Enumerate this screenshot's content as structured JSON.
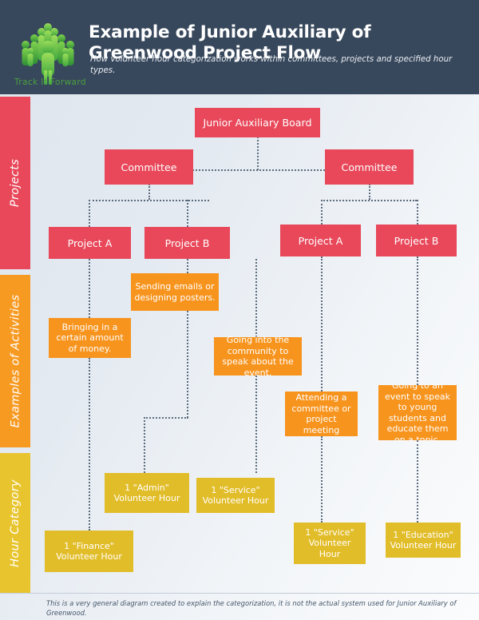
{
  "header": {
    "title": "Example of Junior Auxiliary of Greenwood Project Flow",
    "subtitle": "How volunteer hour categorization works within committees, projects and specified hour types.",
    "logo_wordmark": "Track It Forward",
    "logo_icon": "tree-of-people-logo",
    "bg_color": "#38485c"
  },
  "bands": [
    {
      "label": "Projects",
      "color": "#e8485a"
    },
    {
      "label": "Examples of Activities",
      "color": "#f79a22"
    },
    {
      "label": "Hour Category",
      "color": "#e8c52e"
    }
  ],
  "nodes": {
    "board": "Junior Auxiliary Board",
    "committee_left": "Committee",
    "committee_right": "Committee",
    "project_a_left": "Project A",
    "project_b_left": "Project B",
    "project_a_right": "Project A",
    "project_b_right": "Project B",
    "activity_emails": "Sending emails or designing posters.",
    "activity_money": "Bringing in a certain amount of money.",
    "activity_community": "Going into the community to speak about the event.",
    "activity_meeting": "Attending a committee or project meeting",
    "activity_education": "Going to an event to speak to young students and educate them on a topic.",
    "hour_admin": "1 \"Admin\" Volunteer Hour",
    "hour_service_left": "1 \"Service\" Volunteer Hour",
    "hour_finance": "1 \"Finance\" Volunteer Hour",
    "hour_service_right": "1 \"Service\" Volunteer Hour",
    "hour_education": "1 \"Education\" Volunteer Hour"
  },
  "footer": {
    "note": "This is a very general diagram created to explain the categorization, it is not the actual system used for Junior Auxiliary of Greenwood."
  },
  "colors": {
    "red": "#e8485a",
    "orange": "#f7941e",
    "yellow": "#e2bd2a",
    "connector": "#5b6b7d",
    "header_bg": "#38485c",
    "logo_green": "#4aa03f"
  }
}
